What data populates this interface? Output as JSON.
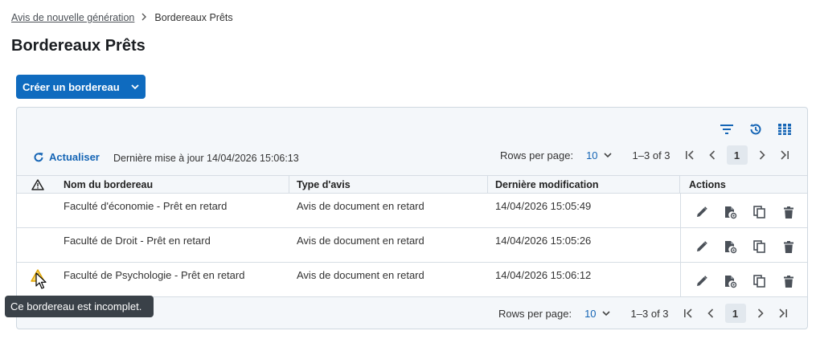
{
  "breadcrumb": {
    "parent": "Avis de nouvelle génération",
    "current": "Bordereaux Prêts"
  },
  "page_title": "Bordereaux Prêts",
  "create_button": {
    "label": "Créer un bordereau"
  },
  "toolbar": {
    "refresh_label": "Actualiser",
    "last_update": "Dernière mise à jour 14/04/2026 15:06:13"
  },
  "pagination": {
    "rows_label": "Rows per page:",
    "rows_value": "10",
    "range": "1–3 of 3",
    "page": "1"
  },
  "table": {
    "headers": {
      "warning": "",
      "name": "Nom du bordereau",
      "type": "Type d'avis",
      "modified": "Dernière modification",
      "actions": "Actions"
    },
    "rows": [
      {
        "name": "Faculté d'économie - Prêt en retard",
        "type": "Avis de document en retard",
        "modified": "14/04/2026 15:05:49",
        "warning": false
      },
      {
        "name": "Faculté de Droit - Prêt en retard",
        "type": "Avis de document en retard",
        "modified": "14/04/2026 15:05:26",
        "warning": false
      },
      {
        "name": "Faculté de Psychologie - Prêt en retard",
        "type": "Avis de document en retard",
        "modified": "14/04/2026 15:06:12",
        "warning": true
      }
    ]
  },
  "tooltip": {
    "text": "Ce bordereau est incomplet."
  },
  "colors": {
    "primary": "#0f6bbf",
    "link": "#1565b5",
    "warning": "#e0a400",
    "tooltip_bg": "#3a4148"
  },
  "icons": {
    "filter": "filter-icon",
    "history": "history-icon",
    "columns": "columns-icon",
    "refresh": "refresh-icon",
    "edit": "pencil-icon",
    "preview": "document-preview-icon",
    "copy": "copy-icon",
    "delete": "trash-icon",
    "warning": "warning-icon"
  }
}
